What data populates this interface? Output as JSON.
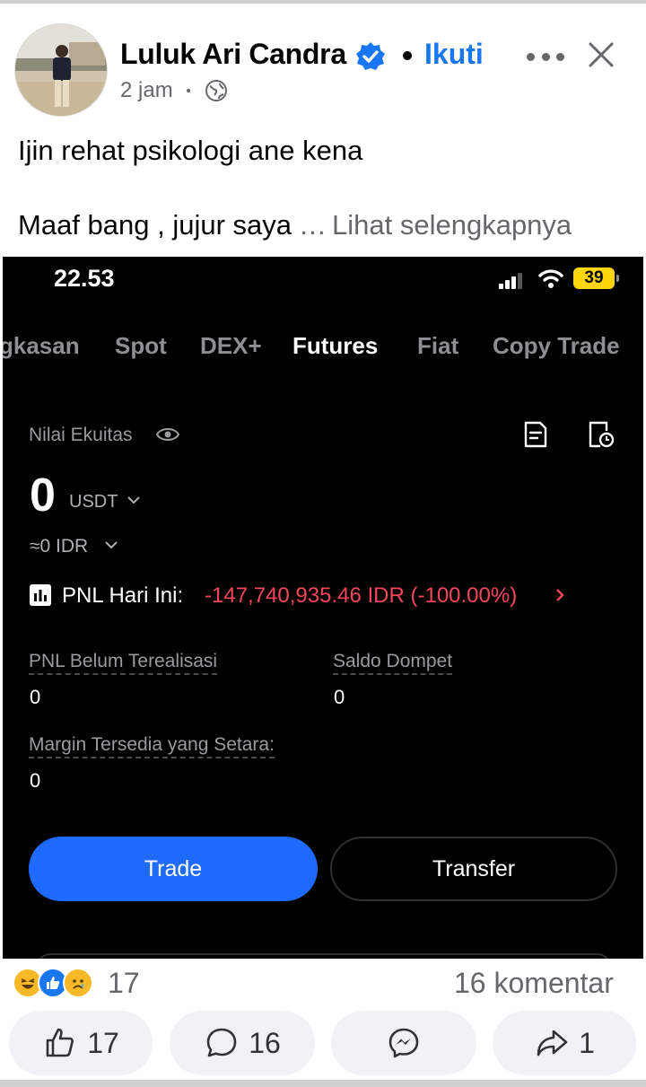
{
  "post": {
    "author": "Luluk Ari Candra",
    "follow_label": "Ikuti",
    "time": "2 jam",
    "text_line1": "Ijin rehat psikologi ane kena",
    "text_line2": "Maaf bang , jujur saya",
    "ellipsis": "…",
    "see_more": "Lihat selengkapnya"
  },
  "screenshot": {
    "status_time": "22.53",
    "battery": "39",
    "tabs": [
      "gkasan",
      "Spot",
      "DEX+",
      "Futures",
      "Fiat",
      "Copy Trade"
    ],
    "active_tab": "Futures",
    "equity_label": "Nilai Ekuitas",
    "equity_value": "0",
    "equity_unit": "USDT",
    "equity_idr": "≈0 IDR",
    "pnl_label": "PNL Hari Ini:",
    "pnl_value": "-147,740,935.46 IDR (-100.00%)",
    "unrealized_label": "PNL Belum Terealisasi",
    "unrealized_value": "0",
    "wallet_label": "Saldo Dompet",
    "wallet_value": "0",
    "margin_label": "Margin Tersedia yang Setara:",
    "margin_value": "0",
    "trade_button": "Trade",
    "transfer_button": "Transfer"
  },
  "stats": {
    "reactions_count": "17",
    "comments": "16 komentar"
  },
  "actions": {
    "like_count": "17",
    "comment_count": "16",
    "share_count": "1"
  },
  "colors": {
    "facebook_blue": "#1877f2",
    "loss_red": "#f6465d",
    "trade_blue": "#1f6bff"
  }
}
